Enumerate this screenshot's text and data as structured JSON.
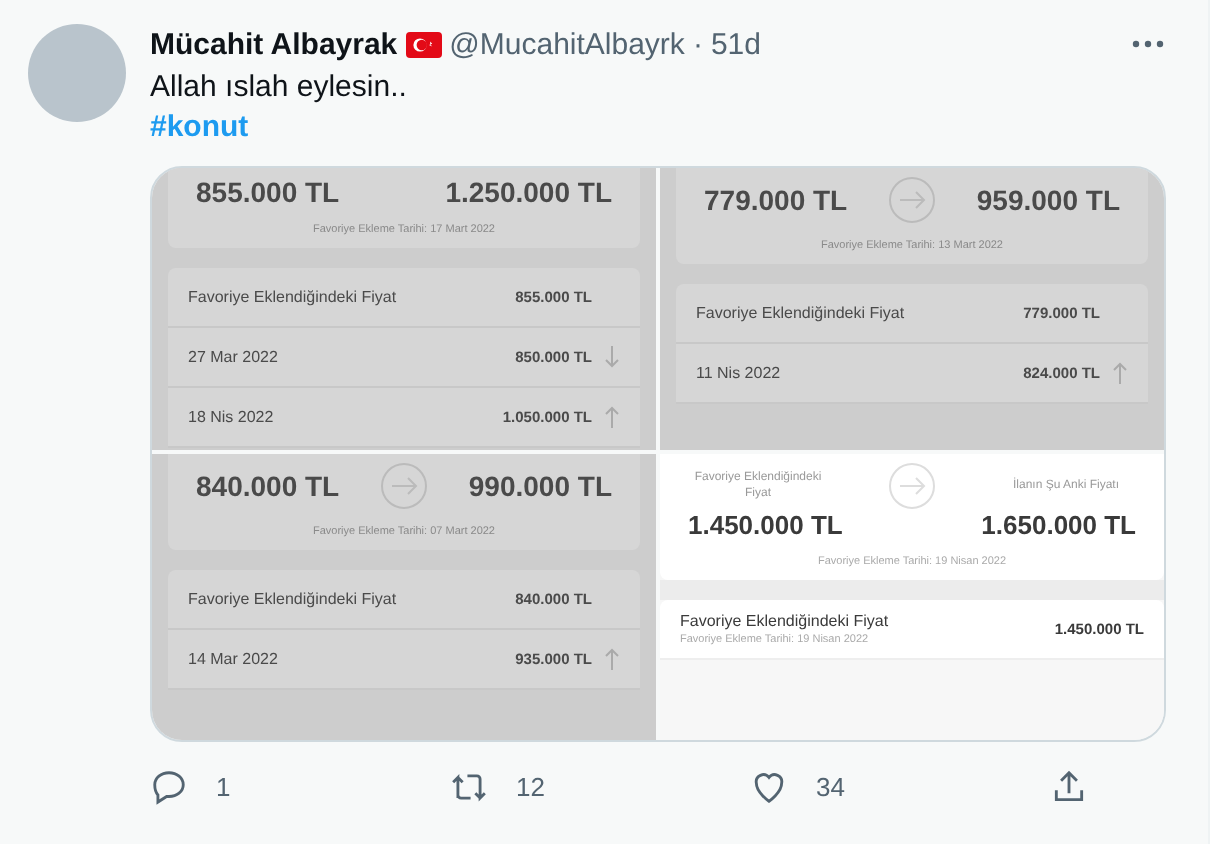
{
  "tweet": {
    "author": {
      "name": "Mücahit Albayrak",
      "handle": "@MucahitAlbayrk",
      "separator": "·",
      "time": "51d"
    },
    "text": "Allah ıslah eylesin..",
    "hashtag": "#konut",
    "media": [
      {
        "dimmed": true,
        "top": {
          "from_price": "855.000 TL",
          "to_price": "1.250.000 TL",
          "date": "Favoriye Ekleme Tarihi: 17 Mart 2022"
        },
        "rows": [
          {
            "label": "Favoriye Eklendiğindeki Fiyat",
            "price": "855.000 TL"
          },
          {
            "label": "27 Mar 2022",
            "price": "850.000 TL",
            "rose": false
          },
          {
            "label": "18 Nis 2022",
            "price": "1.050.000 TL",
            "rose": true
          }
        ]
      },
      {
        "dimmed": true,
        "top": {
          "from_price": "779.000 TL",
          "to_price": "959.000 TL",
          "date": "Favoriye Ekleme Tarihi: 13 Mart 2022"
        },
        "rows": [
          {
            "label": "Favoriye Eklendiğindeki Fiyat",
            "price": "779.000 TL"
          },
          {
            "label": "11 Nis 2022",
            "price": "824.000 TL",
            "rose": true
          }
        ]
      },
      {
        "dimmed": true,
        "top": {
          "from_price": "840.000 TL",
          "to_price": "990.000 TL",
          "date": "Favoriye Ekleme Tarihi: 07 Mart 2022"
        },
        "rows": [
          {
            "label": "Favoriye Eklendiğindeki Fiyat",
            "price": "840.000 TL"
          },
          {
            "label": "14 Mar 2022",
            "price": "935.000 TL",
            "rose": true
          }
        ]
      },
      {
        "dimmed": false,
        "top": {
          "from_label": "Favoriye Eklendiğindeki Fiyat",
          "to_label": "İlanın Şu Anki Fiyatı",
          "from_price": "1.450.000 TL",
          "to_price": "1.650.000 TL",
          "date": "Favoriye Ekleme Tarihi: 19 Nisan 2022"
        },
        "rows": [
          {
            "label": "Favoriye Eklendiğindeki Fiyat",
            "sublabel": "Favoriye Ekleme Tarihi: 19 Nisan 2022",
            "price": "1.450.000 TL"
          }
        ]
      }
    ],
    "actions": [
      {
        "kind": "reply",
        "count": "1"
      },
      {
        "kind": "retweet",
        "count": "12"
      },
      {
        "kind": "like",
        "count": "34"
      },
      {
        "kind": "share"
      }
    ]
  }
}
